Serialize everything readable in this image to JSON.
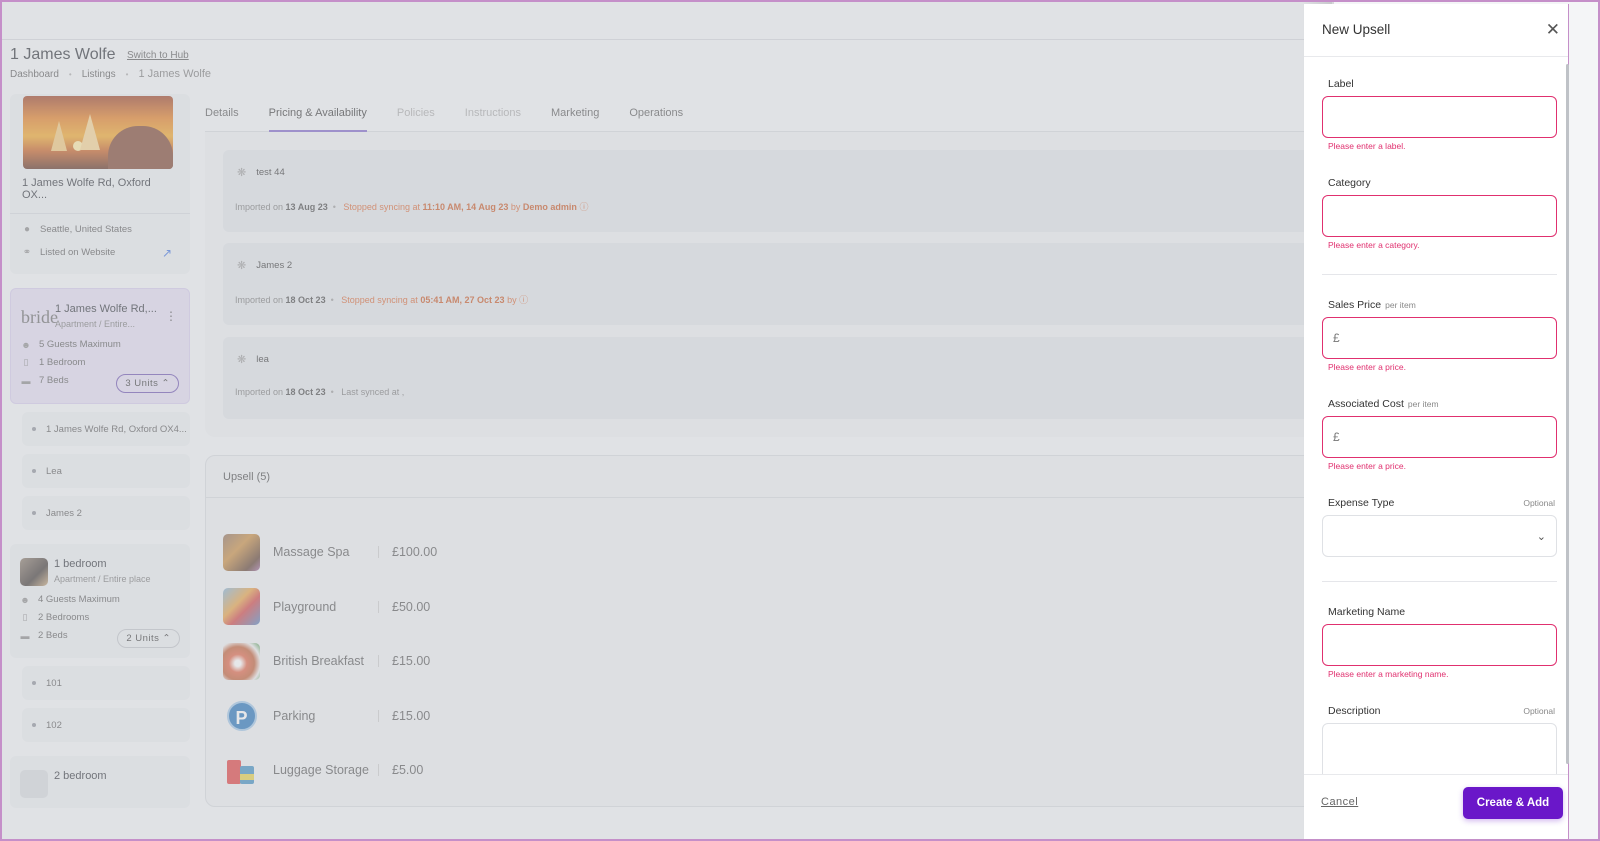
{
  "header": {
    "title": "1 James Wolfe",
    "switch_link": "Switch to Hub",
    "breadcrumb": [
      "Dashboard",
      "Listings",
      "1 James Wolfe"
    ]
  },
  "sidebar": {
    "top_card": {
      "address": "1 James Wolfe Rd, Oxford OX...",
      "location": "Seattle, United States",
      "website": "Listed on Website"
    },
    "groups": [
      {
        "title": "1 James Wolfe Rd,...",
        "subtitle": "Apartment / Entire...",
        "logo_text": "bride",
        "guests": "5 Guests Maximum",
        "bedrooms": "1 Bedroom",
        "beds": "7 Beds",
        "units": "3 Units",
        "unit_items": [
          "1 James Wolfe Rd, Oxford OX4...",
          "Lea",
          "James 2"
        ]
      },
      {
        "title": "1 bedroom",
        "subtitle": "Apartment / Entire place",
        "guests": "4 Guests Maximum",
        "bedrooms": "2 Bedrooms",
        "beds": "2 Beds",
        "units": "2 Units",
        "unit_items": [
          "101",
          "102"
        ]
      },
      {
        "title": "2 bedroom"
      }
    ]
  },
  "tabs": [
    {
      "label": "Details",
      "state": "normal"
    },
    {
      "label": "Pricing & Availability",
      "state": "active"
    },
    {
      "label": "Policies",
      "state": "disabled"
    },
    {
      "label": "Instructions",
      "state": "disabled"
    },
    {
      "label": "Marketing",
      "state": "normal"
    },
    {
      "label": "Operations",
      "state": "normal"
    }
  ],
  "sync_cards": [
    {
      "name": "test 44",
      "imported_prefix": "Imported on",
      "imported_date": "13 Aug 23",
      "status_prefix": "Stopped syncing at",
      "status_time": "11:10 AM, 14 Aug 23",
      "status_by": "by",
      "status_user": "Demo admin"
    },
    {
      "name": "James 2",
      "imported_prefix": "Imported on",
      "imported_date": "18 Oct 23",
      "status_prefix": "Stopped syncing at",
      "status_time": "05:41 AM, 27 Oct 23",
      "status_by": "by",
      "status_user": ""
    },
    {
      "name": "lea",
      "imported_prefix": "Imported on",
      "imported_date": "18 Oct 23",
      "last_synced": "Last synced at ,"
    }
  ],
  "upsell": {
    "heading": "Upsell (5)",
    "items": [
      {
        "name": "Massage Spa",
        "price": "£100.00"
      },
      {
        "name": "Playground",
        "price": "£50.00"
      },
      {
        "name": "British Breakfast",
        "price": "£15.00"
      },
      {
        "name": "Parking",
        "price": "£15.00"
      },
      {
        "name": "Luggage Storage",
        "price": "£5.00"
      }
    ]
  },
  "drawer": {
    "title": "New Upsell",
    "label": {
      "label": "Label",
      "value": "",
      "error": "Please enter a label."
    },
    "category": {
      "label": "Category",
      "value": "",
      "error": "Please enter a category."
    },
    "sales_price": {
      "label": "Sales Price",
      "suffix": "per item",
      "currency": "£",
      "value": "",
      "error": "Please enter a price."
    },
    "associated_cost": {
      "label": "Associated Cost",
      "suffix": "per item",
      "currency": "£",
      "value": "",
      "error": "Please enter a price."
    },
    "expense_type": {
      "label": "Expense Type",
      "optional": "Optional",
      "value": ""
    },
    "marketing_name": {
      "label": "Marketing Name",
      "value": "",
      "error": "Please enter a marketing name."
    },
    "description": {
      "label": "Description",
      "optional": "Optional",
      "value": ""
    },
    "cancel_label": "Cancel",
    "create_label": "Create & Add"
  },
  "colors": {
    "accent": "#6a17c9",
    "error": "#e0306f",
    "warning": "#d9632f",
    "tab_indicator": "#7d63c9"
  }
}
